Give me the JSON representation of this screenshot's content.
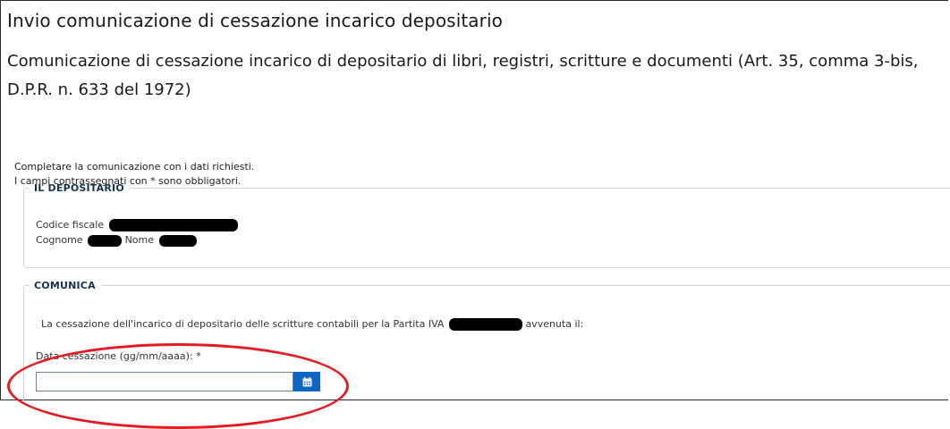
{
  "page": {
    "title": "Invio comunicazione di cessazione incarico depositario",
    "subtitle": "Comunicazione di cessazione incarico di depositario di libri, registri, scritture e documenti (Art. 35, comma 3-bis, D.P.R. n. 633 del 1972)"
  },
  "intro": {
    "line1": "Completare la comunicazione con i dati richiesti.",
    "line2": "I campi contrassegnati con * sono obbligatori."
  },
  "depositario": {
    "legend": "IL DEPOSITARIO",
    "codice_fiscale_label": "Codice fiscale",
    "cognome_label": "Cognome",
    "nome_label": "Nome"
  },
  "comunica": {
    "legend": "COMUNICA",
    "text_before": "La cessazione dell'incarico di depositario delle scritture contabili per la Partita IVA",
    "text_after": "avvenuta il:",
    "date_label": "Data cessazione (gg/mm/aaaa): *",
    "date_value": "",
    "date_placeholder": ""
  },
  "colors": {
    "accent": "#0d66c2",
    "legend": "#17324d",
    "highlight_circle": "#e21b23"
  },
  "icons": {
    "calendar_button": "calendar-icon"
  }
}
